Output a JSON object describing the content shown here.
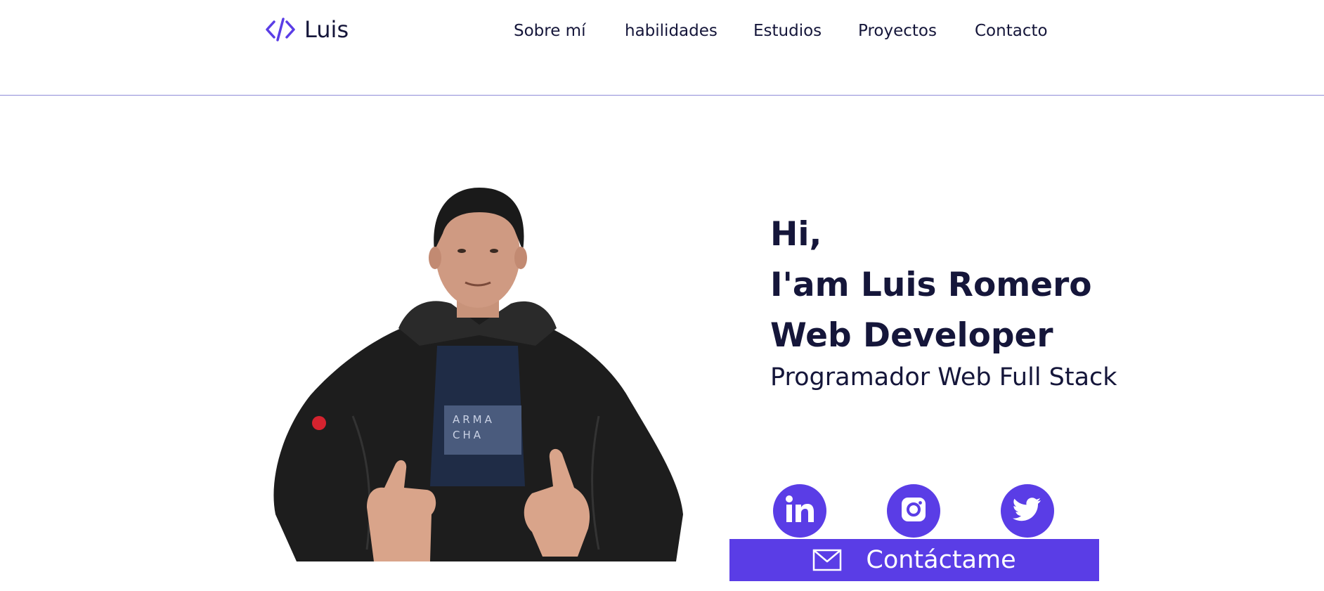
{
  "header": {
    "brand_icon": "code-icon",
    "brand_name": "Luis",
    "nav": [
      {
        "label": "Sobre mí"
      },
      {
        "label": "habilidades"
      },
      {
        "label": "Estudios"
      },
      {
        "label": "Proyectos"
      },
      {
        "label": "Contacto"
      }
    ]
  },
  "hero": {
    "photo_icon": "profile-photo",
    "line1": "Hi,",
    "line2": "I'am Luis Romero",
    "line3": "Web Developer",
    "subtitle": "Programador Web Full Stack",
    "social": [
      {
        "icon": "linkedin-icon"
      },
      {
        "icon": "instagram-icon"
      },
      {
        "icon": "twitter-icon"
      }
    ],
    "contact_icon": "mail-icon",
    "contact_label": "Contáctame"
  },
  "colors": {
    "accent": "#5a3de6",
    "text": "#15163a",
    "divider": "#8f8cd8",
    "background": "#ffffff"
  }
}
